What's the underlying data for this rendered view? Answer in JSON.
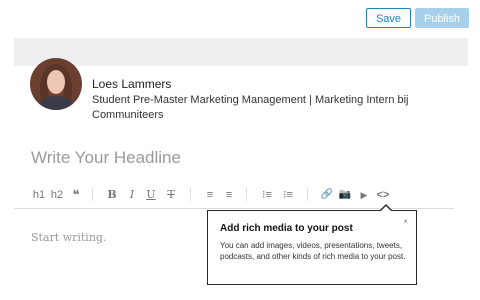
{
  "header": {
    "save_label": "Save",
    "publish_label": "Publish"
  },
  "author": {
    "name": "Loes Lammers",
    "headline": "Student Pre-Master Marketing Management | Marketing Intern bij Communiteers"
  },
  "editor": {
    "headline_placeholder": "Write Your Headline",
    "body_placeholder": "Start writing."
  },
  "toolbar": {
    "h1": "h1",
    "h2": "h2",
    "quote": "❝",
    "bold": "B",
    "italic": "I",
    "underline": "U",
    "strike": "T",
    "align_left": "≡",
    "align_center": "≡",
    "bullets": "⁝≡",
    "numbered": "⁝≡",
    "link": "🔗",
    "camera": "📷",
    "play": "▶",
    "embed": "<>"
  },
  "tooltip": {
    "title": "Add rich media to your post",
    "body": "You can add images, videos, presentations, tweets, podcasts, and other kinds of rich media to your post.",
    "close": "×"
  },
  "colors": {
    "accent": "#1f83c4",
    "publish_disabled": "#a7d0ec",
    "band": "#eceeef"
  }
}
